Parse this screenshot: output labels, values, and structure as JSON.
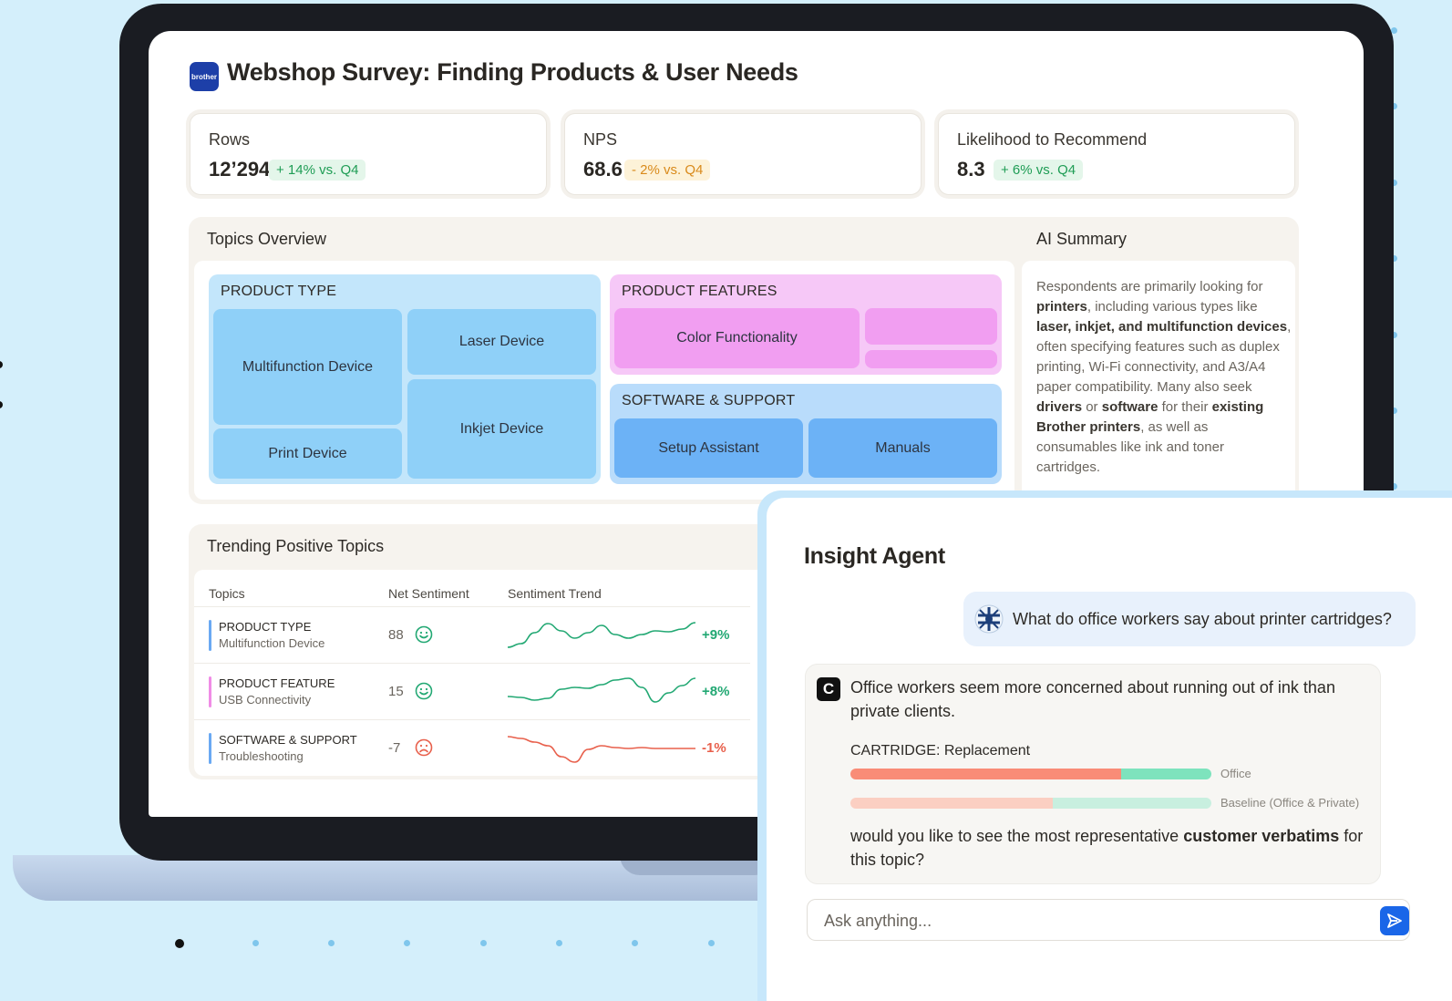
{
  "dashboard": {
    "logo_text": "brother",
    "title": "Webshop Survey: Finding Products & User Needs",
    "kpis": [
      {
        "label": "Rows",
        "value": "12’294",
        "delta": "+ 14% vs. Q4"
      },
      {
        "label": "NPS",
        "value": "68.6",
        "delta": "- 2% vs. Q4"
      },
      {
        "label": "Likelihood to Recommend",
        "value": "8.3",
        "delta": "+ 6% vs. Q4"
      }
    ],
    "topics_overview": {
      "title": "Topics Overview",
      "product_type": {
        "label": "PRODUCT TYPE",
        "tiles": [
          "Multifunction Device",
          "Laser Device",
          "Print Device",
          "Inkjet Device"
        ]
      },
      "product_features": {
        "label": "PRODUCT FEATURES",
        "tiles": [
          "Color Functionality"
        ]
      },
      "software_support": {
        "label": "SOFTWARE & SUPPORT",
        "tiles": [
          "Setup Assistant",
          "Manuals"
        ]
      }
    },
    "ai_summary": {
      "title": "AI Summary",
      "parts": [
        "Respondents are primarily looking for ",
        "printers",
        ", including various types like ",
        "laser, inkjet, and multifunction devices",
        ", often specifying features such as duplex printing, Wi-Fi connectivity, and A3/A4 paper compatibility. Many also seek ",
        "drivers",
        " or ",
        "software",
        " for their ",
        "existing Brother printers",
        ", as well as consumables like ink and toner cartridges."
      ]
    },
    "trending": {
      "title": "Trending Positive Topics",
      "columns": [
        "Topics",
        "Net Sentiment",
        "Sentiment Trend"
      ],
      "rows": [
        {
          "category": "PRODUCT TYPE",
          "topic": "Multifunction Device",
          "score": "88",
          "delta": "+9%",
          "trend": [
            30,
            26,
            14,
            4,
            12,
            20,
            14,
            6,
            16,
            20,
            16,
            12,
            13,
            10,
            3
          ],
          "positive": true,
          "color": "#6aa9f3"
        },
        {
          "category": "PRODUCT FEATURE",
          "topic": "USB Connectivity",
          "score": "15",
          "delta": "+8%",
          "trend": [
            22,
            23,
            26,
            24,
            14,
            12,
            13,
            9,
            4,
            2,
            12,
            28,
            18,
            10,
            2
          ],
          "positive": true,
          "color": "#f08ce6"
        },
        {
          "category": "SOFTWARE & SUPPORT",
          "topic": "Troubleshooting",
          "score": "-7",
          "delta": "-1%",
          "trend": [
            4,
            6,
            10,
            14,
            26,
            32,
            18,
            14,
            16,
            17,
            16,
            17,
            17,
            17,
            17
          ],
          "positive": false,
          "color": "#6aa9f3"
        }
      ]
    }
  },
  "agent": {
    "title": "Insight Agent",
    "question": "What do office workers say about printer cartridges?",
    "reply_logo": "C",
    "reply": "Office workers seem more concerned about running out of ink than private clients.",
    "breakdown": {
      "label": "CARTRIDGE: Replacement",
      "bars": [
        {
          "name": "Office",
          "negative_share": 0.75
        },
        {
          "name": "Baseline (Office & Private)",
          "negative_share": 0.56
        }
      ]
    },
    "followup_pre": "would you like to see the most representative ",
    "followup_bold": "customer verbatims",
    "followup_post": " for this topic?",
    "input_placeholder": "Ask anything..."
  },
  "colors": {
    "positive": "#22a873",
    "negative": "#e8604c",
    "neutral_badge": "#d98a1b",
    "accent": "#1a66e8"
  }
}
